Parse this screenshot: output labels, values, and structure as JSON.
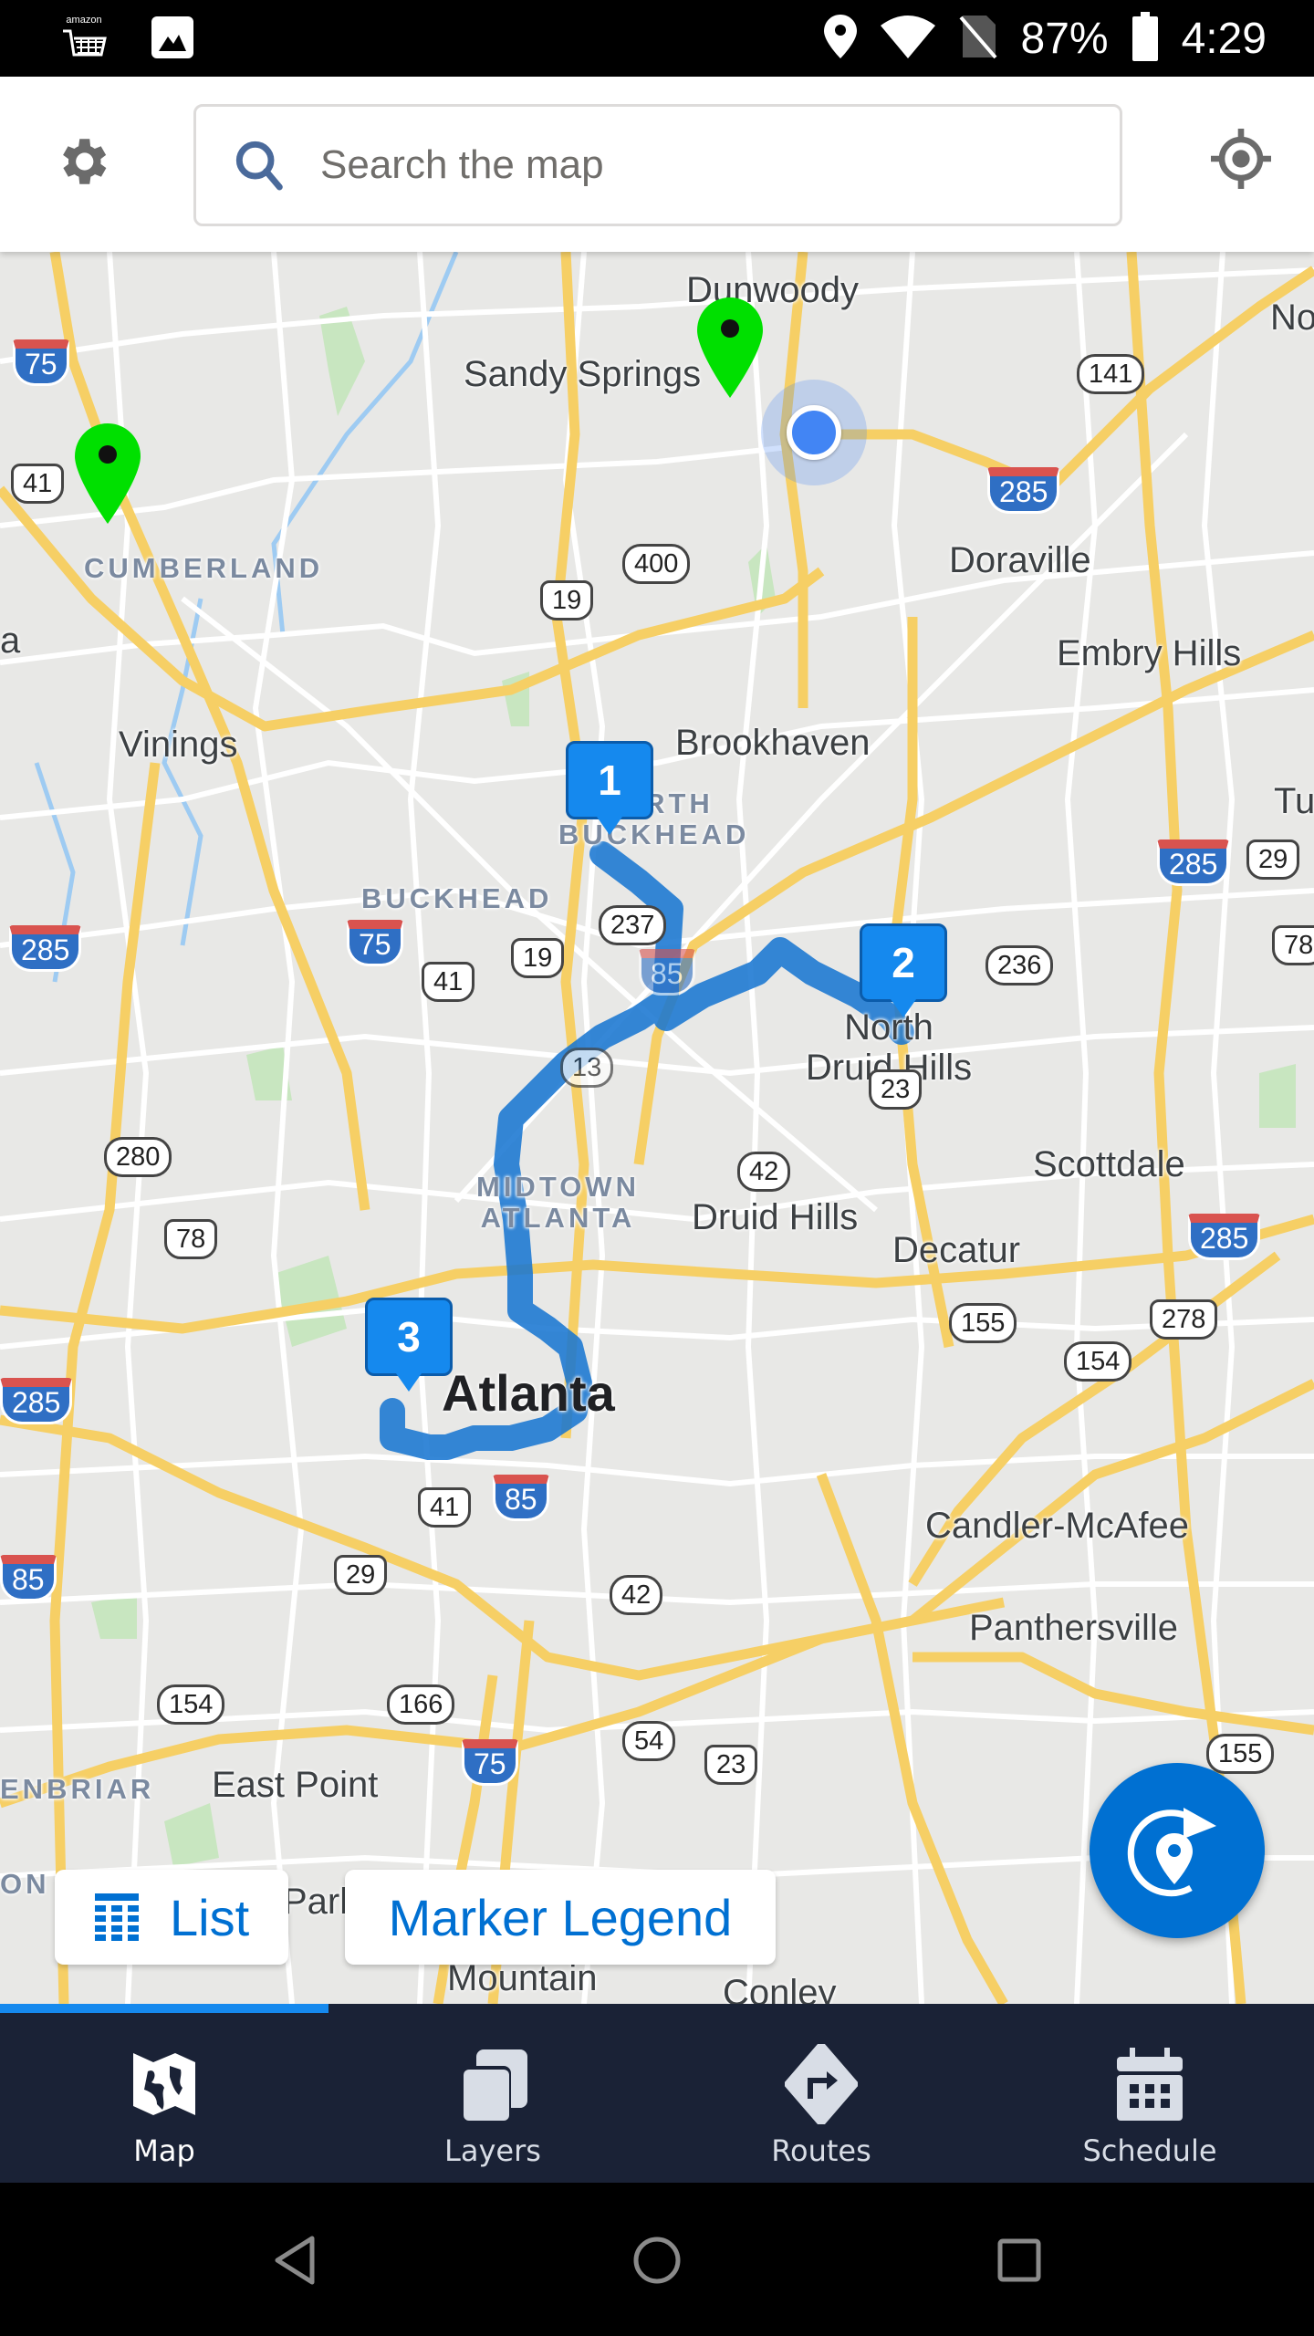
{
  "status_bar": {
    "left_icons": [
      "amazon-shopping-icon",
      "image-icon"
    ],
    "amazon_word": "amazon",
    "right_icons": [
      "location-icon",
      "wifi-icon",
      "no-sim-icon",
      "battery-icon"
    ],
    "battery": "87%",
    "time": "4:29"
  },
  "header": {
    "settings_icon": "gear-icon",
    "search_placeholder": "Search the map",
    "search_value": "",
    "locate_icon": "crosshair-icon"
  },
  "map": {
    "labels": {
      "dunwoody": "Dunwoody",
      "sandy_springs": "Sandy Springs",
      "cumberland": "CUMBERLAND",
      "doraville": "Doraville",
      "embry_hills": "Embry Hills",
      "vinings": "Vinings",
      "brookhaven": "Brookhaven",
      "north_buckhead": "NORTH\nBUCKHEAD",
      "buckhead": "BUCKHEAD",
      "north_druid_hills": "North Druid Hills",
      "midtown": "MIDTOWN\nATLANTA",
      "druid_hills": "Druid Hills",
      "scottdale": "Scottdale",
      "decatur": "Decatur",
      "atlanta": "Atlanta",
      "candler_mcafee": "Candler-McAfee",
      "panthersville": "Panthersville",
      "east_point": "East Point",
      "glenbriar": "ENBRIAR",
      "mountain": "Mountain",
      "conley": "Conley",
      "park": "Park",
      "no_edge": "No",
      "tu_edge": "Tu",
      "a_edge": "a",
      "on_edge": "ON"
    },
    "shields": {
      "i75_nw": "75",
      "us41_nw": "41",
      "ga400": "400",
      "us19_n": "19",
      "ga141": "141",
      "i285_ne": "285",
      "i285_e": "285",
      "us29_e": "29",
      "us78_e": "78",
      "ga236": "236",
      "i285_w": "285",
      "i75_mid": "75",
      "us41_mid": "41",
      "us19_mid": "19",
      "ga237": "237",
      "i85_mid": "85",
      "ga13": "13",
      "us23": "23",
      "ga280": "280",
      "us78_w": "78",
      "ga42_n": "42",
      "i285_se": "285",
      "ga155": "155",
      "us278": "278",
      "ga154_e": "154",
      "i285_sw": "285",
      "us41_s": "41",
      "i85_s": "85",
      "i85_w": "85",
      "us29_s": "29",
      "ga42_s": "42",
      "ga154_w": "154",
      "ga166": "166",
      "ga54": "54",
      "i75_s": "75",
      "us23_s": "23",
      "ga155_se": "155"
    },
    "route_markers": [
      {
        "label": "1"
      },
      {
        "label": "2"
      },
      {
        "label": "3"
      }
    ],
    "route_color": "#1976d2",
    "green_pins": 2,
    "current_location": true,
    "list_button": {
      "icon": "table-grid-icon",
      "label": "List"
    },
    "legend_button": {
      "label": "Marker Legend"
    },
    "fab": {
      "icon": "route-location-refresh-icon"
    }
  },
  "tabs": [
    {
      "label": "Map",
      "icon": "map-icon",
      "active": true
    },
    {
      "label": "Layers",
      "icon": "layers-icon",
      "active": false
    },
    {
      "label": "Routes",
      "icon": "routes-icon",
      "active": false
    },
    {
      "label": "Schedule",
      "icon": "calendar-icon",
      "active": false
    }
  ],
  "nav_bar": {
    "back": "back-icon",
    "home": "home-icon",
    "recents": "recents-icon"
  },
  "colors": {
    "brand_blue": "#0070d2",
    "marker_blue": "#1589ee",
    "tab_bar_bg": "#1a2236",
    "green_pin": "#00e000"
  }
}
